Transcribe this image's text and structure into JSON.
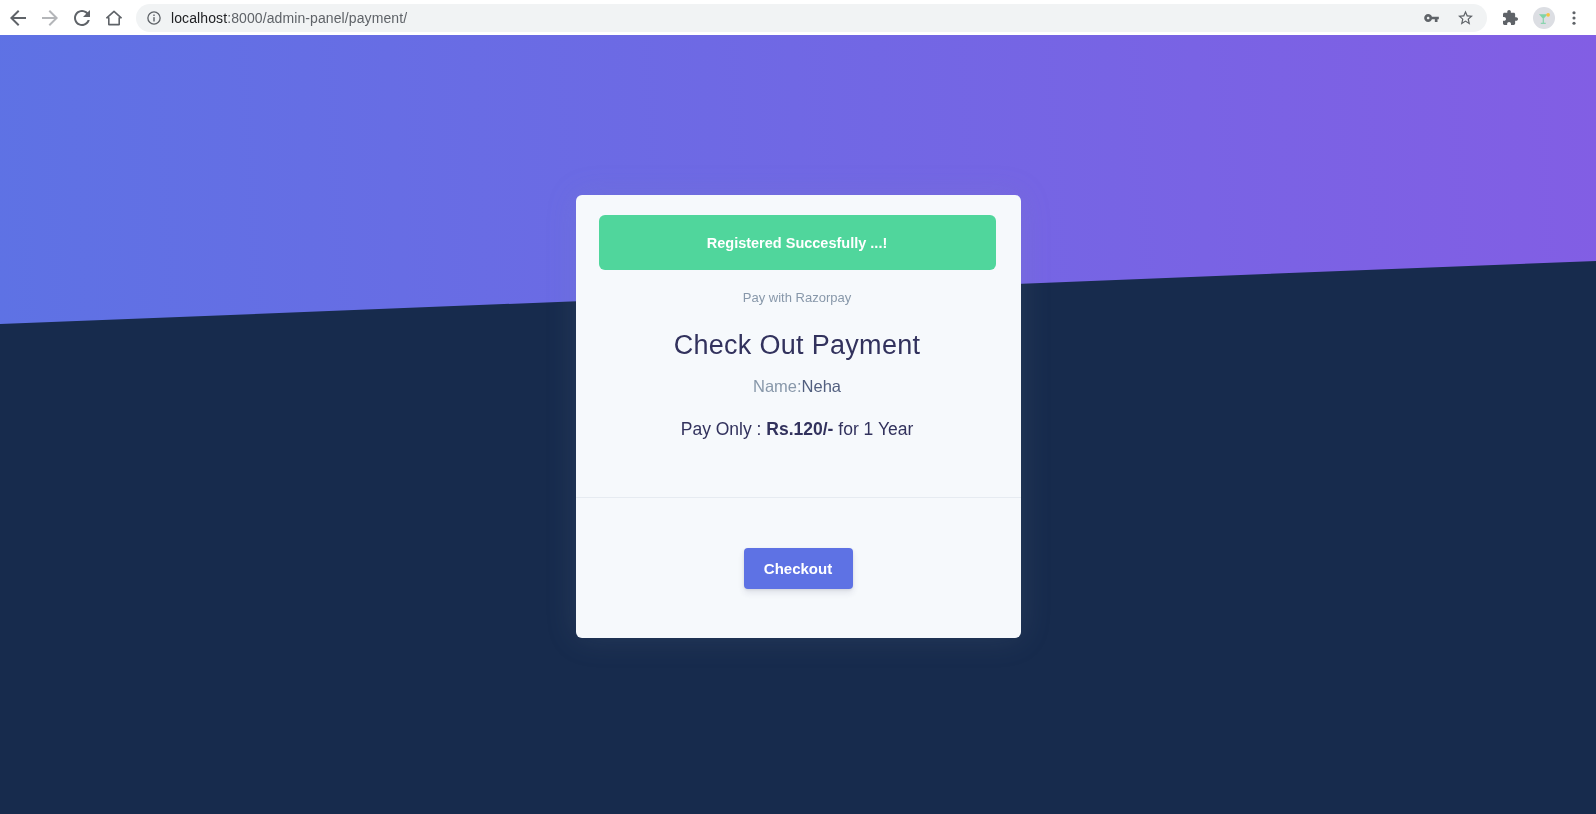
{
  "browser": {
    "nav_buttons": [
      {
        "kind": "back",
        "disabled": false
      },
      {
        "kind": "forward",
        "disabled": true
      },
      {
        "kind": "reload",
        "disabled": false
      },
      {
        "kind": "home",
        "disabled": false
      }
    ],
    "address_bar": {
      "host": "localhost",
      "path": ":8000/admin-panel/payment/"
    }
  },
  "alert": {
    "kind": "success",
    "text": "Registered Succesfully ...!"
  },
  "card": {
    "subtitle": "Pay with Razorpay",
    "title": "Check Out Payment",
    "name_label": "Name:",
    "name_value": "Neha",
    "price_line": "Pay Only : **Rs.120/-** for 1 Year",
    "button": "Checkout"
  }
}
